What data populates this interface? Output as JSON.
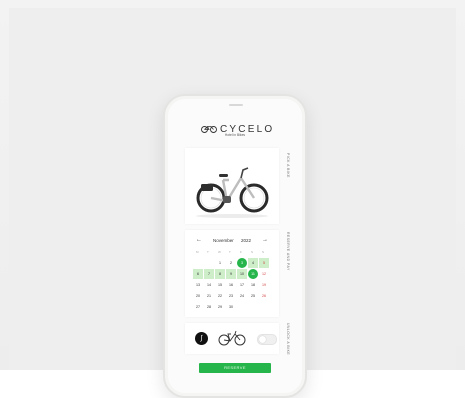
{
  "app": {
    "brand": "CYCELO",
    "tagline": "Hotel in Bikes",
    "reserve_label": "RESERVE"
  },
  "side_labels": {
    "bike": "PICK A BIKE",
    "calendar": "RESERVE AND PAY",
    "unlock": "UNLOCK A BIKE"
  },
  "calendar": {
    "month": "November",
    "year": "2022",
    "prev_icon": "arrow-left-icon",
    "next_icon": "arrow-right-icon",
    "weekdays": [
      "M",
      "T",
      "W",
      "T",
      "F",
      "S",
      "S"
    ],
    "weeks": [
      [
        "",
        "",
        "1",
        "2",
        "3",
        "4",
        "5"
      ],
      [
        "6",
        "7",
        "8",
        "9",
        "10",
        "11",
        "12"
      ],
      [
        "13",
        "14",
        "15",
        "16",
        "17",
        "18",
        "19"
      ],
      [
        "20",
        "21",
        "22",
        "23",
        "24",
        "25",
        "26"
      ],
      [
        "27",
        "28",
        "29",
        "30",
        "",
        "",
        ""
      ]
    ],
    "selected_start": "3",
    "selected_end": "11",
    "highlight_color": "#cdeec8",
    "accent_color": "#25b54a"
  },
  "unlock": {
    "bluetooth_icon": "bluetooth-icon",
    "bike_icon": "bike-icon",
    "toggle_on": false
  }
}
